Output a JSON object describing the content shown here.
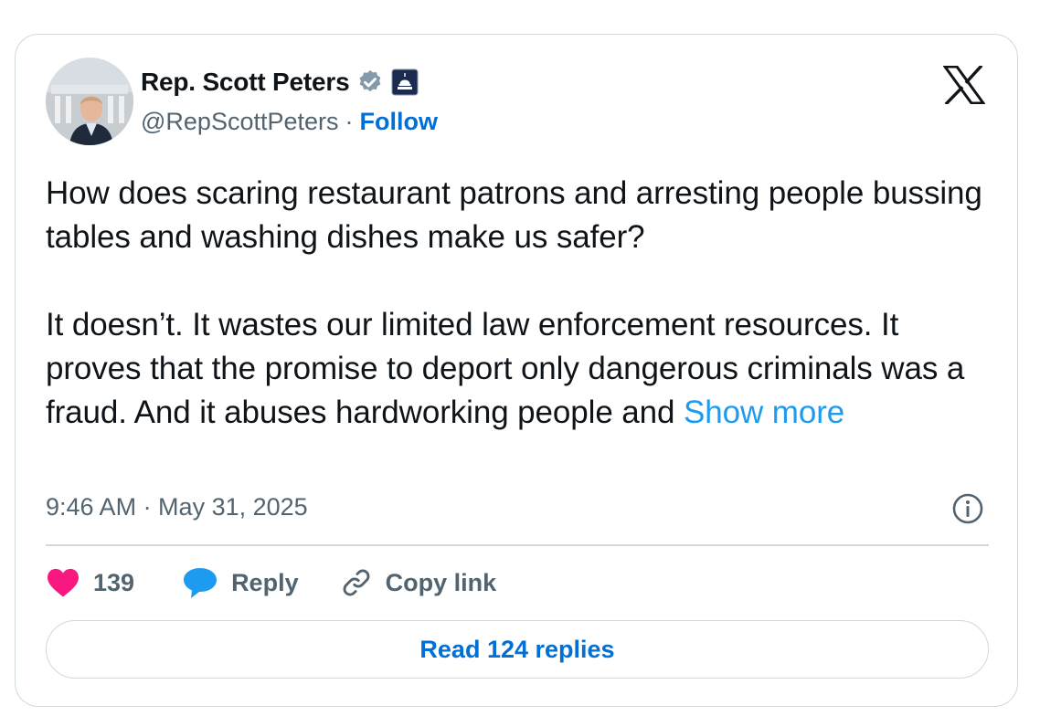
{
  "author": {
    "display_name": "Rep. Scott Peters",
    "handle": "@RepScottPeters",
    "separator": "·",
    "follow_label": "Follow"
  },
  "icons": {
    "verified": "verified-badge-icon",
    "affiliation": "capitol-dome-icon",
    "platform": "x-logo-icon",
    "info": "info-icon",
    "like": "heart-icon",
    "reply": "speech-bubble-icon",
    "copy": "link-icon"
  },
  "tweet": {
    "text": "How does scaring restaurant patrons and arresting people bussing tables and washing dishes make us safer?\n\nIt doesn’t. It wastes our limited law enforcement resources. It proves that the promise to deport only dangerous criminals was a fraud. And it abuses hardworking people and ",
    "show_more_label": "Show more",
    "timestamp": "9:46 AM · May 31, 2025"
  },
  "actions": {
    "like_count": "139",
    "reply_label": "Reply",
    "copy_link_label": "Copy link"
  },
  "read_replies_label": "Read 124 replies",
  "colors": {
    "link_blue": "#006fd6",
    "show_more_blue": "#1d9bf0",
    "like_pink": "#f91880",
    "reply_blue": "#1d9bf0",
    "secondary_text": "#536471",
    "border": "#cfd9de"
  }
}
